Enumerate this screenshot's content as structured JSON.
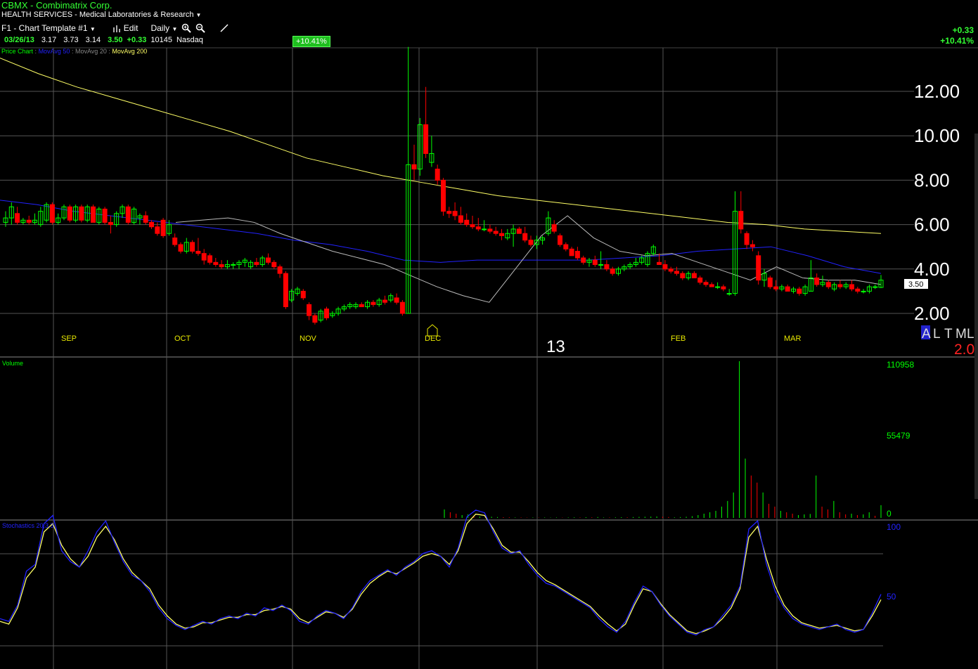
{
  "header": {
    "title": "CBMX - Combimatrix Corp.",
    "sector": "HEALTH SERVICES - Medical Laboratories & Research",
    "template": "F1 - Chart Template #1",
    "edit_label": "Edit",
    "period": "Daily"
  },
  "quote": {
    "date": "03/26/13",
    "open": "3.17",
    "high": "3.73",
    "low": "3.14",
    "close": "3.50",
    "change": "+0.33",
    "volume": "10145",
    "exchange": "Nasdaq",
    "pct_change": "+10.41%"
  },
  "summary": {
    "change": "+0.33",
    "pct_change": "+10.41%"
  },
  "legend": {
    "price_chart": "Price Chart",
    "ma50": "MovAvg 50",
    "ma20": "MovAvg 20",
    "ma200": "MovAvg 200",
    "sep": ":"
  },
  "axis": {
    "price_ticks": [
      "12.00",
      "10.00",
      "8.00",
      "6.00",
      "4.00",
      "2.00"
    ],
    "months": [
      "SEP",
      "OCT",
      "NOV",
      "DEC",
      "FEB",
      "MAR"
    ],
    "year": "13",
    "last_price": "3.50",
    "scale_letters": [
      "A",
      "L",
      "T",
      "M",
      "L"
    ],
    "scale_value": "2.0"
  },
  "volume_panel": {
    "label": "Volume",
    "ticks": [
      "110958",
      "55479",
      "0"
    ]
  },
  "stoch_panel": {
    "label": "Stochastics 20,3,3",
    "ticks": [
      "100",
      "50"
    ]
  },
  "colors": {
    "up": "#00ff00",
    "down": "#ff0000",
    "ma200": "#ffff66",
    "ma50": "#2222ff",
    "ma20": "#bbbbbb",
    "grid": "#555555"
  },
  "chart_data": {
    "type": "candlestick",
    "ylim": [
      1.5,
      14
    ],
    "price_series": [
      {
        "o": 6.1,
        "h": 6.6,
        "l": 5.9,
        "c": 6.3
      },
      {
        "o": 6.3,
        "h": 7.0,
        "l": 6.0,
        "c": 6.8
      },
      {
        "o": 6.5,
        "h": 6.8,
        "l": 6.0,
        "c": 6.1
      },
      {
        "o": 6.1,
        "h": 6.3,
        "l": 6.0,
        "c": 6.2
      },
      {
        "o": 6.2,
        "h": 6.4,
        "l": 6.0,
        "c": 6.1
      },
      {
        "o": 6.1,
        "h": 6.5,
        "l": 6.0,
        "c": 6.2
      },
      {
        "o": 6.0,
        "h": 6.8,
        "l": 5.9,
        "c": 6.6
      },
      {
        "o": 6.2,
        "h": 7.0,
        "l": 6.1,
        "c": 6.9
      },
      {
        "o": 6.9,
        "h": 7.0,
        "l": 6.0,
        "c": 6.1
      },
      {
        "o": 6.1,
        "h": 6.5,
        "l": 6.0,
        "c": 6.3
      },
      {
        "o": 6.3,
        "h": 6.9,
        "l": 6.2,
        "c": 6.8
      },
      {
        "o": 6.8,
        "h": 6.9,
        "l": 6.1,
        "c": 6.2
      },
      {
        "o": 6.2,
        "h": 6.9,
        "l": 6.1,
        "c": 6.8
      },
      {
        "o": 6.8,
        "h": 6.9,
        "l": 6.1,
        "c": 6.2
      },
      {
        "o": 6.2,
        "h": 6.9,
        "l": 6.1,
        "c": 6.8
      },
      {
        "o": 6.8,
        "h": 6.9,
        "l": 6.1,
        "c": 6.1
      },
      {
        "o": 6.1,
        "h": 6.8,
        "l": 6.0,
        "c": 6.7
      },
      {
        "o": 6.7,
        "h": 6.8,
        "l": 6.0,
        "c": 6.1
      },
      {
        "o": 6.1,
        "h": 6.4,
        "l": 5.6,
        "c": 6.0
      },
      {
        "o": 6.0,
        "h": 6.6,
        "l": 5.9,
        "c": 6.5
      },
      {
        "o": 6.5,
        "h": 6.9,
        "l": 6.3,
        "c": 6.8
      },
      {
        "o": 6.8,
        "h": 6.9,
        "l": 6.0,
        "c": 6.1
      },
      {
        "o": 6.1,
        "h": 6.8,
        "l": 6.0,
        "c": 6.7
      },
      {
        "o": 6.3,
        "h": 6.5,
        "l": 6.0,
        "c": 6.4
      },
      {
        "o": 6.4,
        "h": 6.6,
        "l": 6.0,
        "c": 6.1
      },
      {
        "o": 6.1,
        "h": 6.2,
        "l": 5.8,
        "c": 5.9
      },
      {
        "o": 5.9,
        "h": 6.1,
        "l": 5.5,
        "c": 5.6
      },
      {
        "o": 6.2,
        "h": 6.3,
        "l": 5.4,
        "c": 5.5
      },
      {
        "o": 5.6,
        "h": 6.2,
        "l": 5.5,
        "c": 6.0
      },
      {
        "o": 5.4,
        "h": 5.6,
        "l": 5.0,
        "c": 5.1
      },
      {
        "o": 5.1,
        "h": 5.2,
        "l": 4.7,
        "c": 4.8
      },
      {
        "o": 4.8,
        "h": 5.4,
        "l": 4.7,
        "c": 5.2
      },
      {
        "o": 5.2,
        "h": 5.3,
        "l": 4.7,
        "c": 4.8
      },
      {
        "o": 4.8,
        "h": 5.4,
        "l": 4.6,
        "c": 4.7
      },
      {
        "o": 4.7,
        "h": 4.9,
        "l": 4.2,
        "c": 4.4
      },
      {
        "o": 4.6,
        "h": 4.7,
        "l": 4.2,
        "c": 4.3
      },
      {
        "o": 4.3,
        "h": 4.5,
        "l": 4.1,
        "c": 4.2
      },
      {
        "o": 4.2,
        "h": 4.4,
        "l": 4.0,
        "c": 4.1
      },
      {
        "o": 4.1,
        "h": 4.4,
        "l": 4.0,
        "c": 4.2
      },
      {
        "o": 4.2,
        "h": 4.3,
        "l": 4.0,
        "c": 4.2
      },
      {
        "o": 4.2,
        "h": 4.4,
        "l": 4.0,
        "c": 4.3
      },
      {
        "o": 4.3,
        "h": 4.5,
        "l": 4.1,
        "c": 4.4
      },
      {
        "o": 4.1,
        "h": 4.4,
        "l": 4.0,
        "c": 4.3
      },
      {
        "o": 4.3,
        "h": 4.5,
        "l": 4.1,
        "c": 4.2
      },
      {
        "o": 4.2,
        "h": 4.6,
        "l": 4.1,
        "c": 4.5
      },
      {
        "o": 4.5,
        "h": 4.7,
        "l": 4.2,
        "c": 4.3
      },
      {
        "o": 4.3,
        "h": 4.4,
        "l": 4.0,
        "c": 4.1
      },
      {
        "o": 4.1,
        "h": 4.2,
        "l": 3.6,
        "c": 3.8
      },
      {
        "o": 3.8,
        "h": 3.9,
        "l": 2.2,
        "c": 2.3
      },
      {
        "o": 2.6,
        "h": 3.1,
        "l": 2.5,
        "c": 3.0
      },
      {
        "o": 2.9,
        "h": 3.2,
        "l": 2.8,
        "c": 3.1
      },
      {
        "o": 3.0,
        "h": 3.1,
        "l": 2.6,
        "c": 2.7
      },
      {
        "o": 2.4,
        "h": 2.5,
        "l": 1.7,
        "c": 1.9
      },
      {
        "o": 1.9,
        "h": 2.0,
        "l": 1.5,
        "c": 1.6
      },
      {
        "o": 1.7,
        "h": 2.2,
        "l": 1.6,
        "c": 2.1
      },
      {
        "o": 2.2,
        "h": 2.3,
        "l": 1.7,
        "c": 1.8
      },
      {
        "o": 1.9,
        "h": 2.1,
        "l": 1.8,
        "c": 2.0
      },
      {
        "o": 2.0,
        "h": 2.3,
        "l": 1.9,
        "c": 2.2
      },
      {
        "o": 2.2,
        "h": 2.4,
        "l": 2.1,
        "c": 2.3
      },
      {
        "o": 2.3,
        "h": 2.5,
        "l": 2.2,
        "c": 2.4
      },
      {
        "o": 2.3,
        "h": 2.5,
        "l": 2.2,
        "c": 2.4
      },
      {
        "o": 2.4,
        "h": 2.5,
        "l": 2.3,
        "c": 2.3
      },
      {
        "o": 2.3,
        "h": 2.6,
        "l": 2.2,
        "c": 2.5
      },
      {
        "o": 2.5,
        "h": 2.6,
        "l": 2.3,
        "c": 2.4
      },
      {
        "o": 2.4,
        "h": 2.7,
        "l": 2.3,
        "c": 2.6
      },
      {
        "o": 2.6,
        "h": 2.8,
        "l": 2.4,
        "c": 2.5
      },
      {
        "o": 2.6,
        "h": 2.9,
        "l": 2.5,
        "c": 2.8
      },
      {
        "o": 2.7,
        "h": 2.9,
        "l": 2.4,
        "c": 2.5
      },
      {
        "o": 2.5,
        "h": 2.6,
        "l": 1.9,
        "c": 2.0
      },
      {
        "o": 2.0,
        "h": 14.0,
        "l": 2.0,
        "c": 8.7
      },
      {
        "o": 8.7,
        "h": 9.6,
        "l": 8.0,
        "c": 8.5
      },
      {
        "o": 8.5,
        "h": 10.8,
        "l": 8.2,
        "c": 10.5
      },
      {
        "o": 10.5,
        "h": 12.2,
        "l": 9.0,
        "c": 9.2
      },
      {
        "o": 8.8,
        "h": 10.0,
        "l": 8.6,
        "c": 9.2
      },
      {
        "o": 8.5,
        "h": 8.7,
        "l": 7.8,
        "c": 8.0
      },
      {
        "o": 8.0,
        "h": 8.1,
        "l": 6.4,
        "c": 6.6
      },
      {
        "o": 6.6,
        "h": 6.8,
        "l": 6.3,
        "c": 6.5
      },
      {
        "o": 6.6,
        "h": 7.0,
        "l": 6.2,
        "c": 6.4
      },
      {
        "o": 6.4,
        "h": 6.8,
        "l": 6.0,
        "c": 6.1
      },
      {
        "o": 6.2,
        "h": 6.5,
        "l": 5.9,
        "c": 6.0
      },
      {
        "o": 6.0,
        "h": 6.4,
        "l": 5.8,
        "c": 5.9
      },
      {
        "o": 5.9,
        "h": 6.3,
        "l": 5.7,
        "c": 5.8
      },
      {
        "o": 5.8,
        "h": 6.2,
        "l": 5.7,
        "c": 5.8
      },
      {
        "o": 5.8,
        "h": 6.0,
        "l": 5.6,
        "c": 5.7
      },
      {
        "o": 5.7,
        "h": 5.9,
        "l": 5.5,
        "c": 5.6
      },
      {
        "o": 5.6,
        "h": 5.8,
        "l": 5.3,
        "c": 5.5
      },
      {
        "o": 5.4,
        "h": 5.8,
        "l": 5.3,
        "c": 5.6
      },
      {
        "o": 5.6,
        "h": 6.0,
        "l": 5.0,
        "c": 5.8
      },
      {
        "o": 5.8,
        "h": 5.9,
        "l": 5.6,
        "c": 5.6
      },
      {
        "o": 5.6,
        "h": 5.9,
        "l": 5.2,
        "c": 5.3
      },
      {
        "o": 5.3,
        "h": 5.5,
        "l": 5.0,
        "c": 5.1
      },
      {
        "o": 5.1,
        "h": 5.5,
        "l": 4.9,
        "c": 5.3
      },
      {
        "o": 5.3,
        "h": 5.5,
        "l": 5.1,
        "c": 5.4
      },
      {
        "o": 5.6,
        "h": 6.6,
        "l": 5.5,
        "c": 6.3
      },
      {
        "o": 6.0,
        "h": 6.2,
        "l": 5.6,
        "c": 5.7
      },
      {
        "o": 5.5,
        "h": 5.6,
        "l": 5.0,
        "c": 5.1
      },
      {
        "o": 5.1,
        "h": 5.2,
        "l": 4.8,
        "c": 4.9
      },
      {
        "o": 4.9,
        "h": 5.0,
        "l": 4.6,
        "c": 4.6
      },
      {
        "o": 4.8,
        "h": 5.0,
        "l": 4.4,
        "c": 4.5
      },
      {
        "o": 4.5,
        "h": 4.6,
        "l": 4.2,
        "c": 4.3
      },
      {
        "o": 4.3,
        "h": 4.5,
        "l": 4.1,
        "c": 4.4
      },
      {
        "o": 4.4,
        "h": 4.6,
        "l": 4.1,
        "c": 4.2
      },
      {
        "o": 4.2,
        "h": 4.8,
        "l": 4.0,
        "c": 4.2
      },
      {
        "o": 4.2,
        "h": 4.4,
        "l": 3.9,
        "c": 4.0
      },
      {
        "o": 4.0,
        "h": 4.1,
        "l": 3.7,
        "c": 3.8
      },
      {
        "o": 3.8,
        "h": 4.1,
        "l": 3.7,
        "c": 4.0
      },
      {
        "o": 4.0,
        "h": 4.2,
        "l": 3.9,
        "c": 4.1
      },
      {
        "o": 4.1,
        "h": 4.3,
        "l": 4.0,
        "c": 4.2
      },
      {
        "o": 4.2,
        "h": 4.5,
        "l": 4.1,
        "c": 4.3
      },
      {
        "o": 4.3,
        "h": 4.6,
        "l": 4.2,
        "c": 4.5
      },
      {
        "o": 4.2,
        "h": 4.8,
        "l": 4.1,
        "c": 4.7
      },
      {
        "o": 4.7,
        "h": 5.1,
        "l": 4.6,
        "c": 5.0
      },
      {
        "o": 4.3,
        "h": 4.7,
        "l": 4.2,
        "c": 4.2
      },
      {
        "o": 4.2,
        "h": 4.4,
        "l": 3.9,
        "c": 4.0
      },
      {
        "o": 4.0,
        "h": 4.1,
        "l": 3.8,
        "c": 3.9
      },
      {
        "o": 3.9,
        "h": 4.1,
        "l": 3.7,
        "c": 3.8
      },
      {
        "o": 3.8,
        "h": 3.9,
        "l": 3.5,
        "c": 3.6
      },
      {
        "o": 3.6,
        "h": 3.9,
        "l": 3.5,
        "c": 3.8
      },
      {
        "o": 3.8,
        "h": 3.9,
        "l": 3.6,
        "c": 3.6
      },
      {
        "o": 3.6,
        "h": 3.7,
        "l": 3.3,
        "c": 3.4
      },
      {
        "o": 3.4,
        "h": 3.5,
        "l": 3.2,
        "c": 3.3
      },
      {
        "o": 3.3,
        "h": 3.4,
        "l": 3.2,
        "c": 3.2
      },
      {
        "o": 3.2,
        "h": 3.4,
        "l": 3.1,
        "c": 3.2
      },
      {
        "o": 3.2,
        "h": 3.3,
        "l": 3.0,
        "c": 3.1
      },
      {
        "o": 2.9,
        "h": 3.1,
        "l": 2.8,
        "c": 2.9
      },
      {
        "o": 2.9,
        "h": 7.5,
        "l": 2.8,
        "c": 6.6
      },
      {
        "o": 6.6,
        "h": 7.5,
        "l": 5.6,
        "c": 5.8
      },
      {
        "o": 5.6,
        "h": 5.7,
        "l": 4.9,
        "c": 5.1
      },
      {
        "o": 5.1,
        "h": 5.3,
        "l": 4.8,
        "c": 5.0
      },
      {
        "o": 4.6,
        "h": 4.8,
        "l": 3.3,
        "c": 3.5
      },
      {
        "o": 3.5,
        "h": 4.0,
        "l": 3.2,
        "c": 3.8
      },
      {
        "o": 3.6,
        "h": 3.7,
        "l": 3.1,
        "c": 3.2
      },
      {
        "o": 3.2,
        "h": 3.5,
        "l": 3.0,
        "c": 3.1
      },
      {
        "o": 3.1,
        "h": 3.3,
        "l": 3.0,
        "c": 3.2
      },
      {
        "o": 3.2,
        "h": 3.3,
        "l": 3.0,
        "c": 3.0
      },
      {
        "o": 3.0,
        "h": 3.2,
        "l": 2.9,
        "c": 3.1
      },
      {
        "o": 3.1,
        "h": 3.2,
        "l": 2.8,
        "c": 2.9
      },
      {
        "o": 2.9,
        "h": 3.3,
        "l": 2.8,
        "c": 3.2
      },
      {
        "o": 3.0,
        "h": 4.4,
        "l": 3.0,
        "c": 3.6
      },
      {
        "o": 3.6,
        "h": 3.8,
        "l": 3.2,
        "c": 3.3
      },
      {
        "o": 3.3,
        "h": 3.7,
        "l": 3.2,
        "c": 3.4
      },
      {
        "o": 3.4,
        "h": 3.5,
        "l": 3.1,
        "c": 3.2
      },
      {
        "o": 3.1,
        "h": 3.4,
        "l": 3.0,
        "c": 3.3
      },
      {
        "o": 3.3,
        "h": 3.5,
        "l": 3.1,
        "c": 3.2
      },
      {
        "o": 3.2,
        "h": 3.4,
        "l": 3.1,
        "c": 3.3
      },
      {
        "o": 3.3,
        "h": 3.5,
        "l": 3.0,
        "c": 3.1
      },
      {
        "o": 3.1,
        "h": 3.2,
        "l": 2.9,
        "c": 3.0
      },
      {
        "o": 3.0,
        "h": 3.1,
        "l": 2.9,
        "c": 3.0
      },
      {
        "o": 3.0,
        "h": 3.3,
        "l": 2.9,
        "c": 3.2
      },
      {
        "o": 3.2,
        "h": 3.3,
        "l": 3.1,
        "c": 3.2
      },
      {
        "o": 3.17,
        "h": 3.73,
        "l": 3.14,
        "c": 3.5
      }
    ],
    "ma200": [
      13.5,
      12.8,
      12.2,
      11.7,
      11.2,
      10.7,
      10.2,
      9.6,
      9.0,
      8.6,
      8.2,
      7.9,
      7.6,
      7.3,
      7.1,
      6.9,
      6.7,
      6.5,
      6.3,
      6.1,
      6.0,
      5.8,
      5.7,
      5.6
    ],
    "ma50": [
      7.1,
      6.9,
      6.6,
      6.4,
      6.2,
      6.0,
      5.8,
      5.6,
      5.3,
      5.1,
      4.8,
      4.4,
      4.3,
      4.4,
      4.4,
      4.4,
      4.4,
      4.5,
      4.6,
      4.8,
      4.9,
      5.0,
      4.6,
      4.1,
      3.8
    ],
    "ma20": [
      6.1,
      6.2,
      6.3,
      6.1,
      5.6,
      5.2,
      4.8,
      4.5,
      4.2,
      3.7,
      3.2,
      2.8,
      2.5,
      4.0,
      5.5,
      6.4,
      5.4,
      4.8,
      4.6,
      4.7,
      4.3,
      3.9,
      3.5,
      4.1,
      3.6,
      3.5,
      3.5,
      3.3
    ],
    "volume": [
      6000,
      4000,
      3000,
      2000,
      2500,
      1500,
      1000,
      500,
      800,
      600,
      500,
      400,
      300,
      300,
      200,
      300,
      200,
      300,
      200,
      300,
      200,
      300,
      400,
      300,
      500,
      400,
      600,
      300,
      300,
      400,
      500,
      400,
      600,
      700,
      800,
      900,
      1000,
      800,
      600,
      400,
      600,
      800,
      1200,
      2000,
      3000,
      4000,
      5000,
      8000,
      12000,
      18000,
      110958,
      42000,
      30000,
      25000,
      18000,
      10000,
      8000,
      5000,
      4000,
      3000,
      2000,
      2500,
      2800,
      30000,
      8000,
      6000,
      12000,
      4000,
      2500,
      3000,
      2000,
      2500,
      4000,
      1500,
      9000
    ],
    "stoch_k": [
      20,
      18,
      30,
      55,
      60,
      90,
      96,
      70,
      62,
      58,
      70,
      84,
      92,
      76,
      62,
      52,
      48,
      40,
      28,
      20,
      15,
      12,
      15,
      18,
      16,
      20,
      22,
      20,
      24,
      22,
      28,
      26,
      30,
      26,
      18,
      16,
      22,
      26,
      24,
      20,
      28,
      40,
      48,
      52,
      56,
      52,
      58,
      62,
      68,
      70,
      66,
      58,
      72,
      95,
      100,
      98,
      84,
      72,
      68,
      70,
      60,
      52,
      46,
      44,
      40,
      36,
      32,
      28,
      20,
      14,
      10,
      18,
      32,
      44,
      40,
      30,
      22,
      16,
      10,
      8,
      12,
      14,
      22,
      30,
      44,
      86,
      92,
      60,
      40,
      28,
      20,
      16,
      14,
      12,
      14,
      16,
      12,
      10,
      12,
      24,
      38
    ],
    "stoch_d": [
      18,
      16,
      28,
      50,
      58,
      84,
      90,
      74,
      64,
      58,
      66,
      80,
      88,
      78,
      64,
      54,
      48,
      42,
      30,
      22,
      16,
      13,
      14,
      17,
      17,
      19,
      21,
      21,
      23,
      23,
      26,
      27,
      29,
      27,
      20,
      17,
      21,
      25,
      24,
      21,
      27,
      38,
      46,
      51,
      55,
      53,
      57,
      61,
      66,
      68,
      66,
      60,
      70,
      90,
      97,
      96,
      86,
      74,
      69,
      69,
      62,
      54,
      48,
      45,
      41,
      37,
      33,
      29,
      22,
      16,
      11,
      16,
      30,
      42,
      40,
      31,
      23,
      17,
      11,
      9,
      11,
      14,
      20,
      28,
      42,
      80,
      88,
      64,
      44,
      30,
      22,
      17,
      15,
      13,
      14,
      15,
      13,
      11,
      12,
      22,
      34
    ]
  }
}
